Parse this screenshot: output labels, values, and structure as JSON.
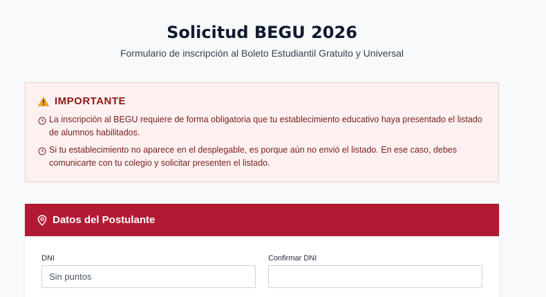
{
  "header": {
    "title": "Solicitud BEGU 2026",
    "subtitle": "Formulario de inscripción al Boleto Estudiantil Gratuito y Universal"
  },
  "alert": {
    "heading": "IMPORTANTE",
    "items": [
      "La inscripción al BEGU requiere de forma obligatoria que tu establecimiento educativo haya presentado el listado de alumnos habilitados.",
      "Si tu establecimiento no aparece en el desplegable, es porque aún no envió el listado. En ese caso, debes comunicarte con tu colegio y solicitar presenten el listado."
    ],
    "colors": {
      "background": "#fdf0f0",
      "text": "#7a1f1f",
      "warning": "#f59e0b"
    }
  },
  "section": {
    "title": "Datos del Postulante",
    "accent_color": "#b21a33",
    "fields": {
      "dni": {
        "label": "DNI",
        "placeholder": "Sin puntos",
        "value": ""
      },
      "confirm_dni": {
        "label": "Confirmar DNI",
        "placeholder": "",
        "value": ""
      }
    }
  }
}
